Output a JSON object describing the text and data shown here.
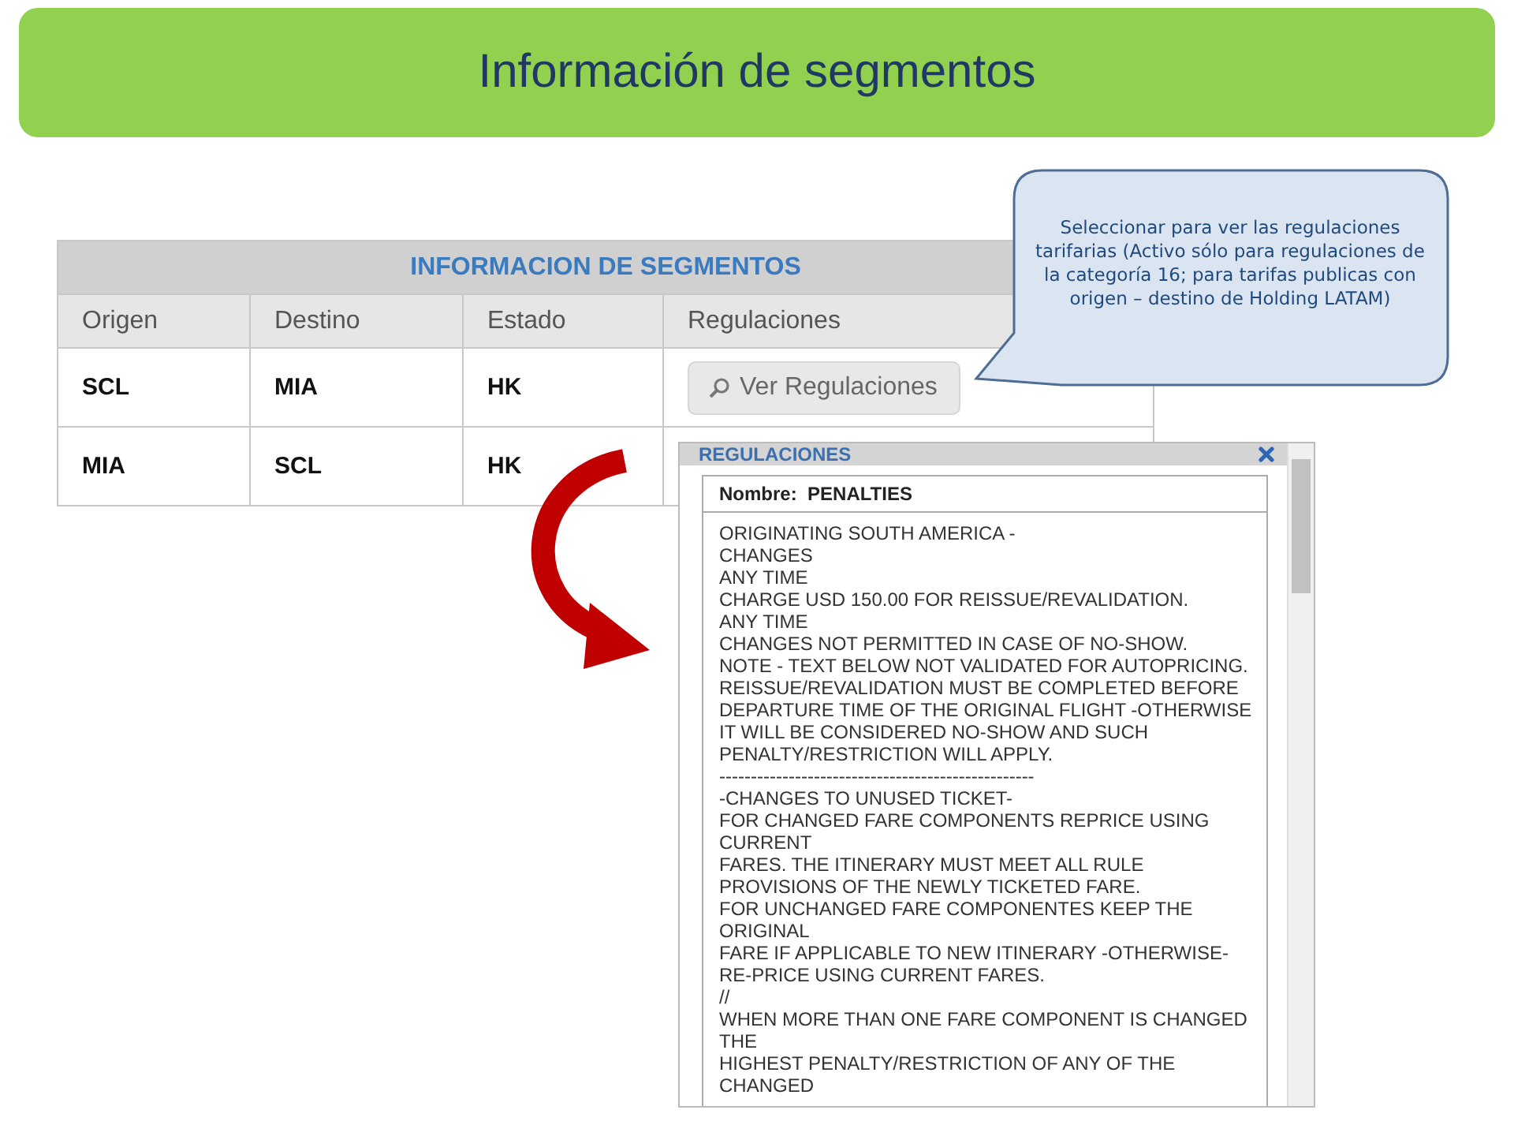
{
  "slide": {
    "title": "Información de segmentos"
  },
  "table": {
    "title": "INFORMACION DE SEGMENTOS",
    "columns": [
      "Origen",
      "Destino",
      "Estado",
      "Regulaciones"
    ],
    "rows": [
      {
        "cells": [
          "SCL",
          "MIA",
          "HK"
        ],
        "action": "Ver Regulaciones"
      },
      {
        "cells": [
          "MIA",
          "SCL",
          "HK"
        ]
      }
    ]
  },
  "callout": {
    "text": "Seleccionar para ver las regulaciones tarifarias (Activo sólo para regulaciones de la categoría 16; para tarifas publicas con origen – destino de Holding LATAM)"
  },
  "dialog": {
    "title": "REGULACIONES",
    "name_label": "Nombre:",
    "name_value": "PENALTIES",
    "lines": [
      "ORIGINATING SOUTH AMERICA -",
      "CHANGES",
      "ANY TIME",
      "CHARGE USD 150.00 FOR REISSUE/REVALIDATION.",
      "ANY TIME",
      "CHANGES NOT PERMITTED IN CASE OF NO-SHOW.",
      "NOTE - TEXT BELOW NOT VALIDATED FOR AUTOPRICING.",
      "REISSUE/REVALIDATION MUST BE COMPLETED BEFORE",
      "DEPARTURE TIME OF THE ORIGINAL FLIGHT -OTHERWISE",
      "IT WILL BE CONSIDERED NO-SHOW AND SUCH",
      "PENALTY/RESTRICTION WILL APPLY.",
      "--------------------------------------------------",
      "-CHANGES TO UNUSED TICKET-",
      "FOR CHANGED FARE COMPONENTS REPRICE USING",
      "CURRENT",
      "FARES. THE ITINERARY MUST MEET ALL RULE",
      "PROVISIONS OF THE NEWLY TICKETED FARE.",
      "FOR UNCHANGED FARE COMPONENTES KEEP THE",
      "ORIGINAL",
      "FARE IF APPLICABLE TO NEW ITINERARY -OTHERWISE-",
      "RE-PRICE USING CURRENT FARES.",
      "//",
      "WHEN MORE THAN ONE FARE COMPONENT IS CHANGED",
      "THE",
      "HIGHEST PENALTY/RESTRICTION OF ANY OF THE",
      "CHANGED"
    ]
  }
}
